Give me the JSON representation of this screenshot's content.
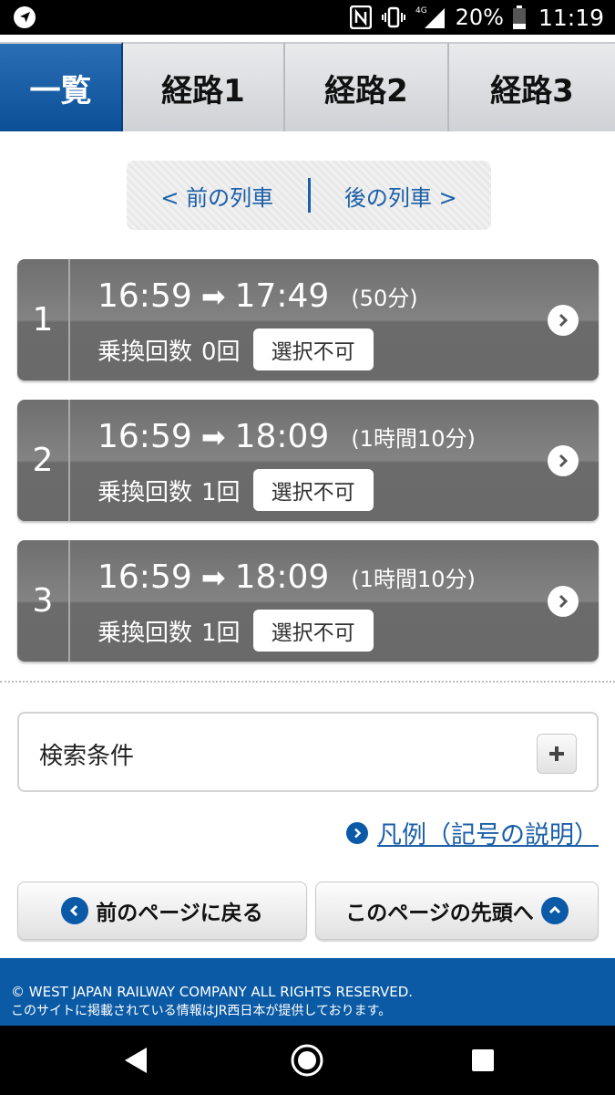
{
  "statusbar": {
    "battery_percent": "20%",
    "time": "11:19",
    "network": "4G"
  },
  "tabs": [
    {
      "label": "一覧",
      "active": true
    },
    {
      "label": "経路1",
      "active": false
    },
    {
      "label": "経路2",
      "active": false
    },
    {
      "label": "経路3",
      "active": false
    }
  ],
  "pager": {
    "prev": "< 前の列車",
    "next": "後の列車 >"
  },
  "routes": [
    {
      "index": "1",
      "depart": "16:59",
      "arrive": "17:49",
      "duration": "(50分)",
      "transfers_label": "乗換回数",
      "transfers": "0回",
      "status": "選択不可"
    },
    {
      "index": "2",
      "depart": "16:59",
      "arrive": "18:09",
      "duration": "(1時間10分)",
      "transfers_label": "乗換回数",
      "transfers": "1回",
      "status": "選択不可"
    },
    {
      "index": "3",
      "depart": "16:59",
      "arrive": "18:09",
      "duration": "(1時間10分)",
      "transfers_label": "乗換回数",
      "transfers": "1回",
      "status": "選択不可"
    }
  ],
  "conditions": {
    "label": "検索条件"
  },
  "legend": {
    "label": "凡例（記号の説明）"
  },
  "buttons": {
    "back": "前のページに戻る",
    "top": "このページの先頭へ"
  },
  "footer": {
    "copyright": "© WEST JAPAN RAILWAY COMPANY ALL RIGHTS RESERVED.",
    "note": "このサイトに掲載されている情報はJR西日本が提供しております。"
  },
  "colors": {
    "brand_blue": "#0b5aa5",
    "card_gray": "#777777",
    "link_blue": "#1b5fa8"
  }
}
